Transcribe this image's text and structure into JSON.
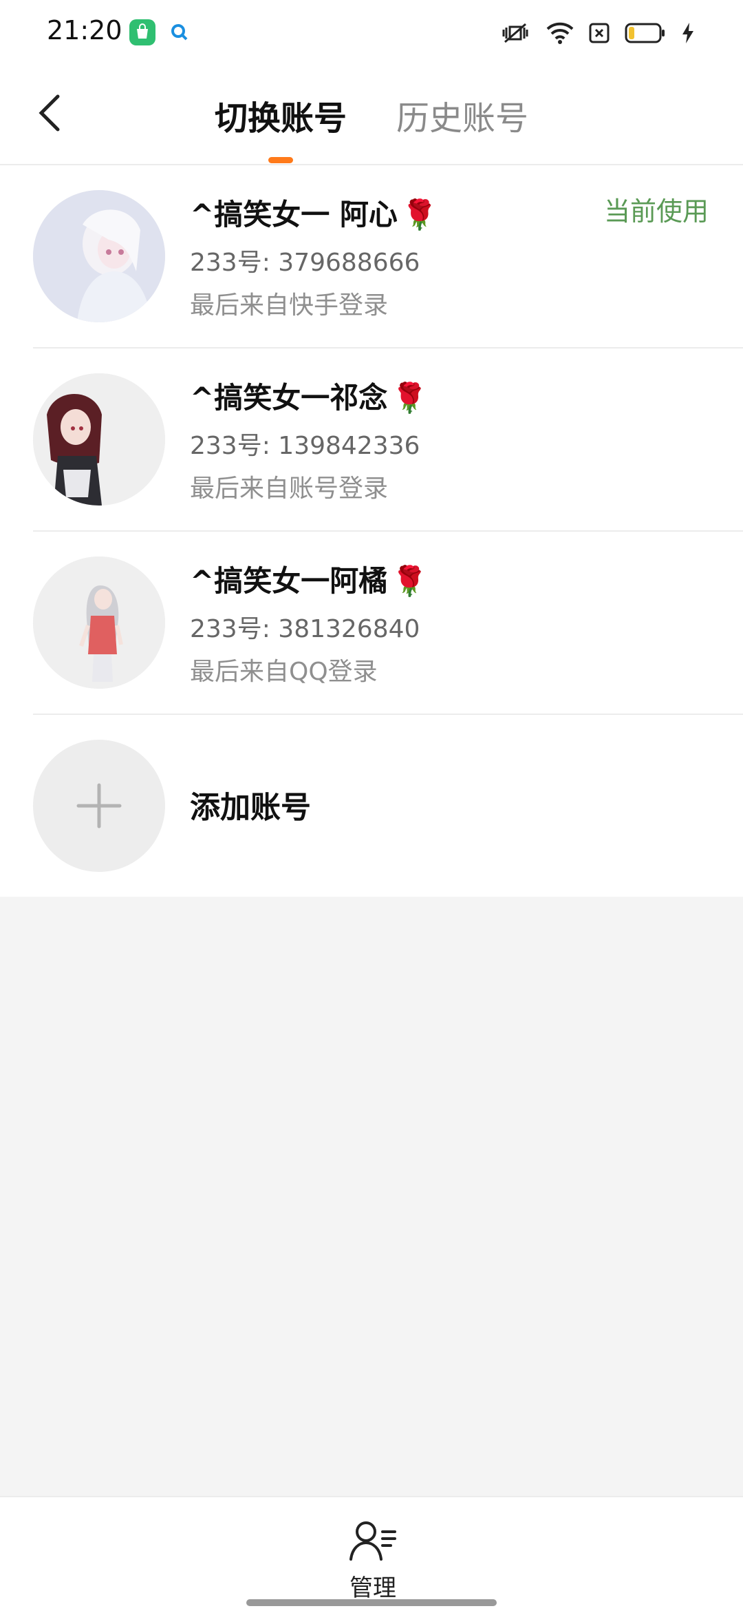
{
  "status_bar": {
    "time": "21:20",
    "icons": [
      "store-app-icon",
      "search-app-icon",
      "mute-vibrate-icon",
      "wifi-icon",
      "sim-error-icon",
      "battery-icon",
      "charging-icon"
    ]
  },
  "header": {
    "back_icon": "chevron-left-icon",
    "tabs": [
      {
        "label": "切换账号",
        "active": true
      },
      {
        "label": "历史账号",
        "active": false
      }
    ],
    "accent": "#ff7a1a"
  },
  "accounts": [
    {
      "name": "^搞笑女一 阿心",
      "emoji": "🌹",
      "id_line": "233号: 379688666",
      "login": "最后来自快手登录",
      "current_label": "当前使用"
    },
    {
      "name": "^搞笑女一祁念",
      "emoji": "🌹",
      "id_line": "233号: 139842336",
      "login": "最后来自账号登录"
    },
    {
      "name": "^搞笑女一阿橘",
      "emoji": "🌹",
      "id_line": "233号: 381326840",
      "login": "最后来自QQ登录"
    }
  ],
  "add_account": {
    "label": "添加账号",
    "icon": "plus-icon"
  },
  "bottom_nav": {
    "label": "管理",
    "icon": "user-manage-icon"
  },
  "colors": {
    "current": "#5a9a55",
    "background": "#f4f4f4"
  }
}
